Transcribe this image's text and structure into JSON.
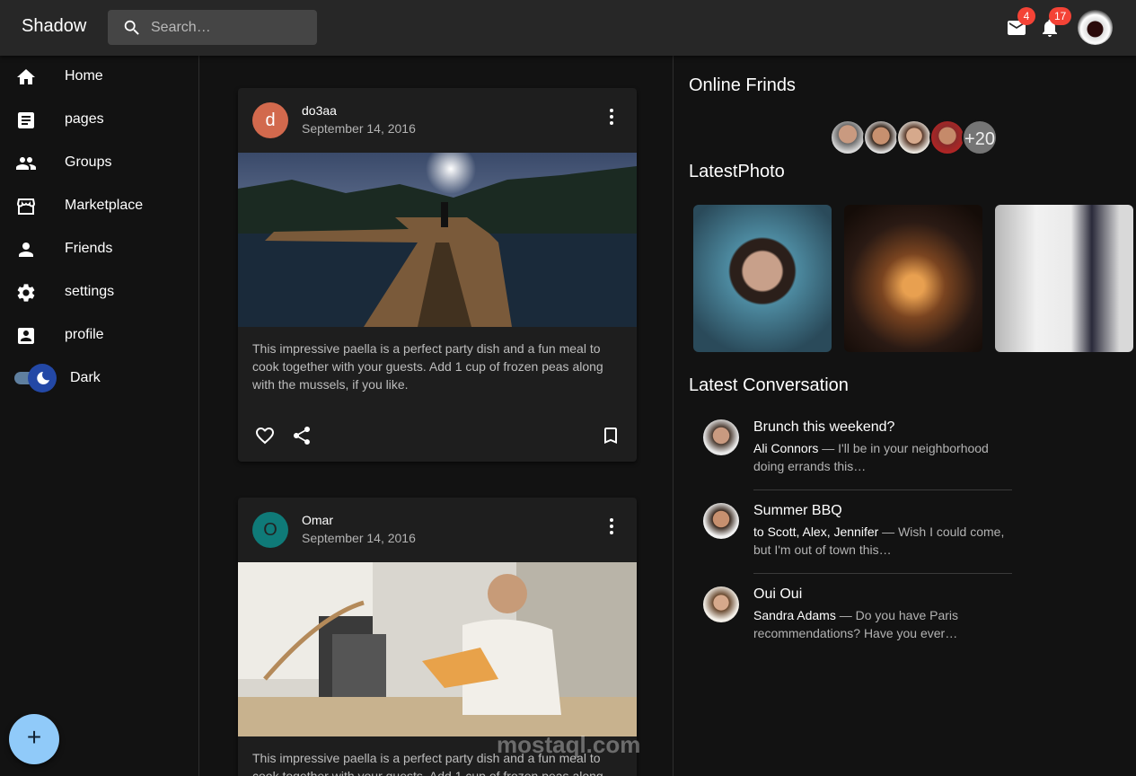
{
  "appbar": {
    "title": "Shadow",
    "search_placeholder": "Search…",
    "mail_count": "4",
    "notif_count": "17"
  },
  "sidebar": {
    "items": [
      {
        "label": "Home",
        "icon": "home-icon"
      },
      {
        "label": "pages",
        "icon": "article-icon"
      },
      {
        "label": "Groups",
        "icon": "group-icon"
      },
      {
        "label": "Marketplace",
        "icon": "store-icon"
      },
      {
        "label": "Friends",
        "icon": "person-icon"
      },
      {
        "label": "settings",
        "icon": "gear-icon"
      },
      {
        "label": "profile",
        "icon": "account-box-icon"
      }
    ],
    "theme_toggle_label": "Dark",
    "fab_label": "+"
  },
  "posts": [
    {
      "avatar_letter": "d",
      "avatar_color": "#d2694d",
      "author": "do3aa",
      "date": "September 14, 2016",
      "text": "This impressive paella is a perfect party dish and a fun meal to cook together with your guests. Add 1 cup of frozen peas along with the mussels, if you like."
    },
    {
      "avatar_letter": "O",
      "avatar_color": "#0f7a78",
      "author": "Omar",
      "date": "September 14, 2016",
      "text": "This impressive paella is a perfect party dish and a fun meal to cook together with your guests. Add 1 cup of frozen peas along with the mussels, if you like."
    }
  ],
  "right": {
    "online_title": "Online Frinds",
    "online_more": "+20",
    "photos_title": "LatestPhoto",
    "conversation_title": "Latest Conversation",
    "conversations": [
      {
        "title": "Brunch this weekend?",
        "who": "Ali Connors",
        "snippet": " — I'll be in your neighborhood doing errands this…"
      },
      {
        "title": "Summer BBQ",
        "who": "to Scott, Alex, Jennifer",
        "snippet": " — Wish I could come, but I'm out of town this…"
      },
      {
        "title": "Oui Oui",
        "who": "Sandra Adams",
        "snippet": " — Do you have Paris recommendations? Have you ever…"
      }
    ]
  },
  "watermark": "mostaql.com",
  "colors": {
    "appbar": "#272727",
    "background": "#121212",
    "card": "#1e1e1e",
    "badge": "#f44336",
    "fab": "#90caf9"
  }
}
